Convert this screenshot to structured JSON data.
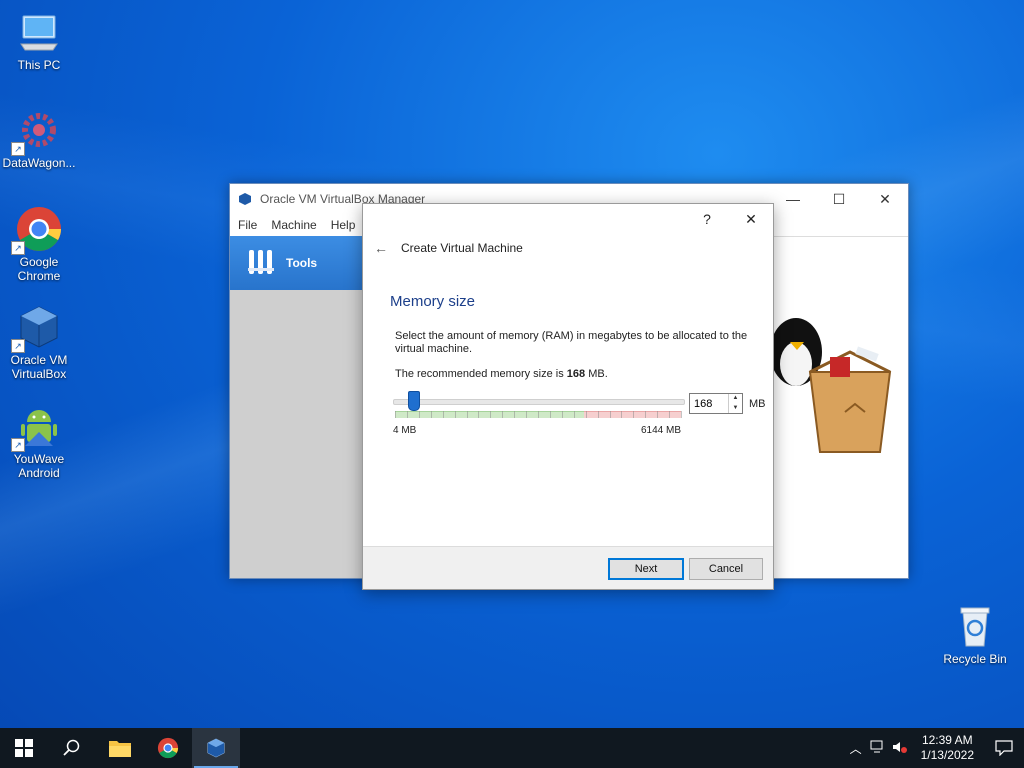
{
  "desktop": {
    "icons": [
      {
        "label": "This PC"
      },
      {
        "label": "DataWagon..."
      },
      {
        "label": "Google Chrome"
      },
      {
        "label": "Oracle VM VirtualBox"
      },
      {
        "label": "YouWave Android"
      },
      {
        "label": "Recycle Bin"
      }
    ]
  },
  "manager": {
    "title": "Oracle VM VirtualBox Manager",
    "menu": [
      "File",
      "Machine",
      "Help"
    ],
    "tools_label": "Tools"
  },
  "dialog": {
    "help_glyph": "?",
    "close_glyph": "✕",
    "back_glyph": "←",
    "header": "Create Virtual Machine",
    "section_title": "Memory size",
    "description": "Select the amount of memory (RAM) in megabytes to be allocated to the virtual machine.",
    "recommended_prefix": "The recommended memory size is ",
    "recommended_value": "168",
    "recommended_suffix": " MB.",
    "memory_value": "168",
    "memory_unit": "MB",
    "slider_min_label": "4 MB",
    "slider_max_label": "6144 MB",
    "slider_min": 4,
    "slider_max": 6144,
    "slider_value": 168,
    "green_fraction": 0.66,
    "next_label": "Next",
    "cancel_label": "Cancel"
  },
  "taskbar": {
    "time": "12:39 AM",
    "date": "1/13/2022"
  },
  "colors": {
    "accent": "#0078d7",
    "tools_blue": "#2874cc"
  }
}
